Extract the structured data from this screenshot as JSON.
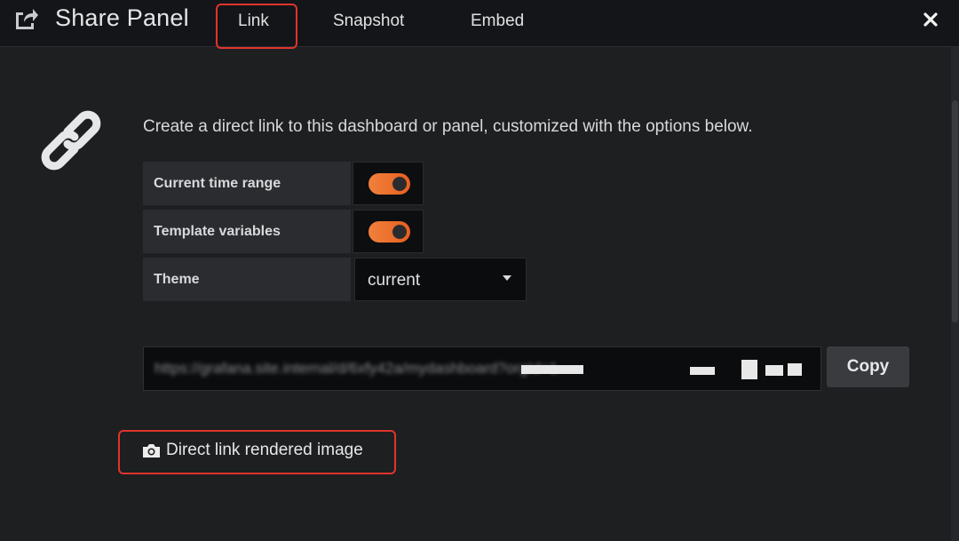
{
  "header": {
    "title": "Share Panel",
    "icon": "share-icon",
    "tabs": [
      {
        "label": "Link",
        "active": true
      },
      {
        "label": "Snapshot",
        "active": false
      },
      {
        "label": "Embed",
        "active": false
      }
    ],
    "close_icon": "close-icon"
  },
  "link_tab": {
    "icon": "link-icon",
    "intro": "Create a direct link to this dashboard or panel, customized with the options below.",
    "options": [
      {
        "label": "Current time range",
        "type": "toggle",
        "checked": true
      },
      {
        "label": "Template variables",
        "type": "toggle",
        "checked": true
      },
      {
        "label": "Theme",
        "type": "select",
        "value": "current"
      }
    ],
    "url_field": {
      "value": "https://grafana.site.internal/d/6xfy42a/mydashboard?orgId=1"
    },
    "copy_label": "Copy",
    "direct_link_label": "Direct link rendered image",
    "direct_link_icon": "camera-icon"
  },
  "colors": {
    "accent": "#f0813c",
    "highlight": "#e0342c",
    "background": "#1e1f21"
  }
}
